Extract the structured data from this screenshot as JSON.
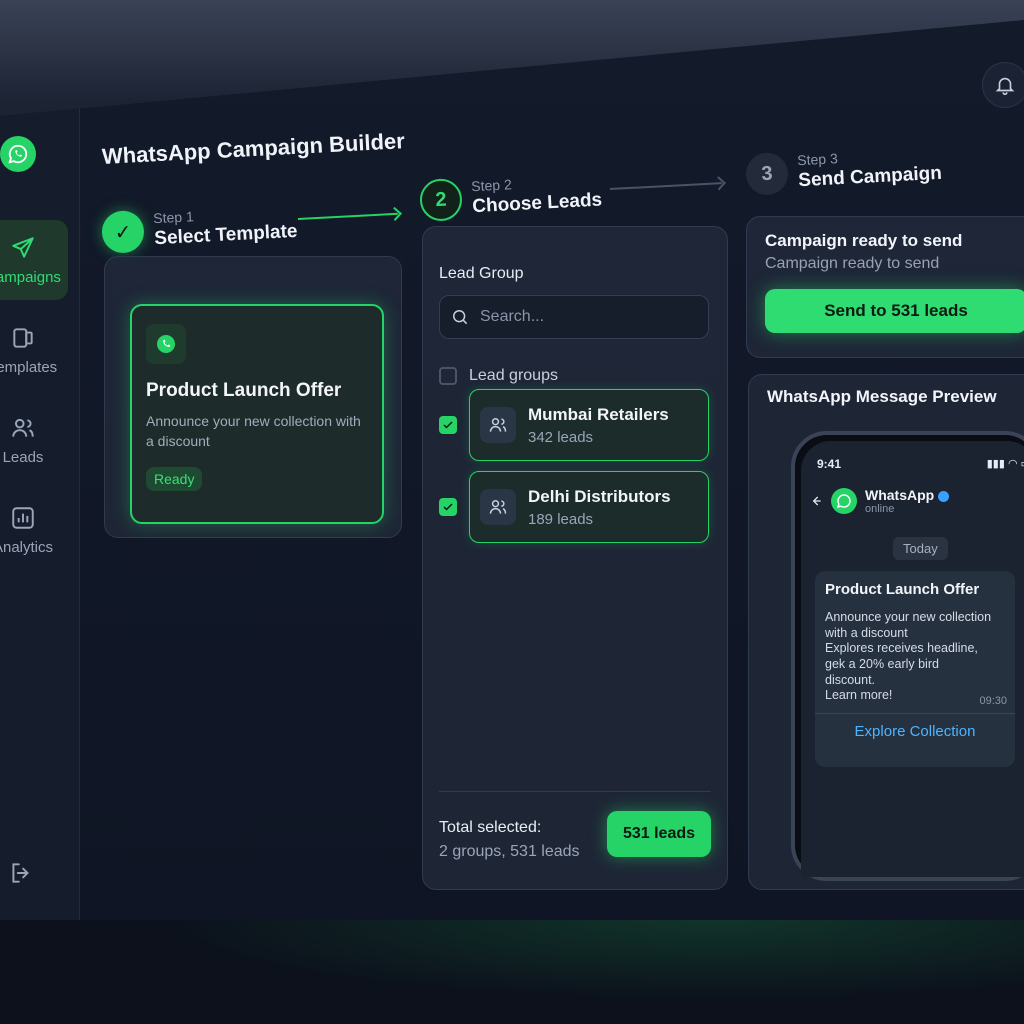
{
  "colors": {
    "accent": "#25d366",
    "background": "#111726",
    "link": "#4fb3ff"
  },
  "page": {
    "title": "WhatsApp Campaign Builder"
  },
  "sidebar": {
    "logo_icon": "whatsapp-icon",
    "items": [
      {
        "label": "Campaigns",
        "icon": "send-icon",
        "active": true
      },
      {
        "label": "Templates",
        "icon": "template-icon",
        "active": false
      },
      {
        "label": "Leads",
        "icon": "users-icon",
        "active": false
      },
      {
        "label": "Analytics",
        "icon": "chart-icon",
        "active": false
      }
    ],
    "logout_icon": "logout-icon"
  },
  "header": {
    "bell_icon": "bell-icon"
  },
  "steps": [
    {
      "number": "✓",
      "sub": "Step 1",
      "label": "Select Template",
      "state": "done"
    },
    {
      "number": "2",
      "sub": "Step 2",
      "label": "Choose Leads",
      "state": "current"
    },
    {
      "number": "3",
      "sub": "Step 3",
      "label": "Send Campaign",
      "state": "todo"
    }
  ],
  "template": {
    "title": "Product Launch Offer",
    "description": "Announce your new collection with a discount",
    "status": "Ready"
  },
  "leads": {
    "heading": "Lead Group",
    "search_placeholder": "Search...",
    "select_all_label": "Lead groups",
    "groups": [
      {
        "name": "Mumbai Retailers",
        "count": "342 leads",
        "checked": true
      },
      {
        "name": "Delhi Distributors",
        "count": "189 leads",
        "checked": true
      }
    ],
    "total_label": "Total selected:",
    "total_sub": "2 groups, 531 leads",
    "total_button": "531 leads"
  },
  "send": {
    "ready_title": "Campaign ready to send",
    "ready_sub": "Campaign ready to send",
    "button": "Send to 531 leads"
  },
  "preview": {
    "title": "WhatsApp Message Preview",
    "time": "9:41",
    "signal": "▮▮▮ ◠ ▭",
    "chat_name": "WhatsApp",
    "chat_status": "online",
    "date_chip": "Today",
    "message_title": "Product Launch Offer",
    "message_lines": [
      "Announce your new collection",
      "with a discount",
      "Explores receives headline,",
      "gek a 20% early bird",
      "discount.",
      "Learn more!"
    ],
    "message_time": "09:30",
    "cta": "Explore Collection"
  }
}
